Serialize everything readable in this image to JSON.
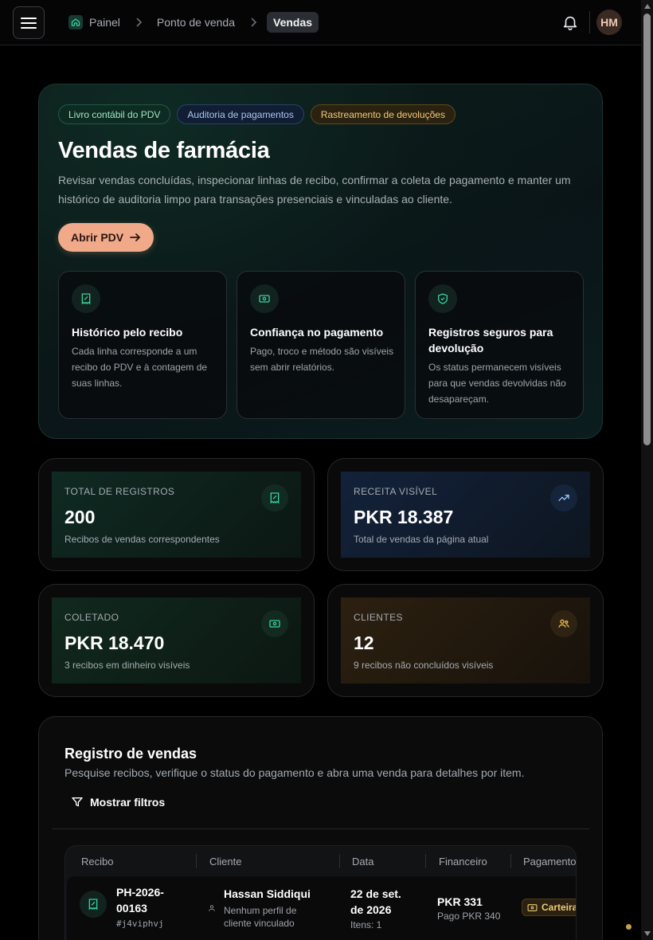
{
  "breadcrumb": {
    "home": "Painel",
    "section": "Ponto de venda",
    "current": "Vendas"
  },
  "user": {
    "initials": "HM"
  },
  "hero": {
    "chips": [
      "Livro contábil do PDV",
      "Auditoria de pagamentos",
      "Rastreamento de devoluções"
    ],
    "title": "Vendas de farmácia",
    "description": "Revisar vendas concluídas, inspecionar linhas de recibo, confirmar a coleta de pagamento e manter um histórico de auditoria limpo para transações presenciais e vinculadas ao cliente.",
    "cta_label": "Abrir PDV",
    "features": [
      {
        "title": "Histórico pelo recibo",
        "text": "Cada linha corresponde a um recibo do PDV e à contagem de suas linhas.",
        "icon": "receipt-icon"
      },
      {
        "title": "Confiança no pagamento",
        "text": "Pago, troco e método são visíveis sem abrir relatórios.",
        "icon": "banknote-icon"
      },
      {
        "title": "Registros seguros para devolução",
        "text": "Os status permanecem visíveis para que vendas devolvidas não desapareçam.",
        "icon": "shield-check-icon"
      }
    ]
  },
  "stats": [
    {
      "label": "TOTAL DE REGISTROS",
      "value": "200",
      "sub": "Recibos de vendas correspondentes",
      "icon": "receipt-icon",
      "accent": "#34d399"
    },
    {
      "label": "RECEITA VISÍVEL",
      "value": "PKR 18.387",
      "sub": "Total de vendas da página atual",
      "icon": "trending-up-icon",
      "accent": "#93c5fd"
    },
    {
      "label": "COLETADO",
      "value": "PKR 18.470",
      "sub": "3 recibos em dinheiro visíveis",
      "icon": "banknote-icon",
      "accent": "#34d399"
    },
    {
      "label": "CLIENTES",
      "value": "12",
      "sub": "9 recibos não concluídos visíveis",
      "icon": "users-icon",
      "accent": "#f0b95a"
    }
  ],
  "register": {
    "title": "Registro de vendas",
    "subtitle": "Pesquise recibos, verifique o status do pagamento e abra uma venda para detalhes por item.",
    "filters_label": "Mostrar filtros",
    "columns": [
      "Recibo",
      "Cliente",
      "Data",
      "Financeiro",
      "Pagamento"
    ],
    "rows": [
      {
        "receipt_line1": "PH-2026-",
        "receipt_line2": "00163",
        "receipt_code": "#j4viphvj",
        "customer": "Hassan Siddiqui",
        "customer_note_line1": "Nenhum perfil de",
        "customer_note_line2": "cliente vinculado",
        "date_line1": "22 de set.",
        "date_line2": "de 2026",
        "items": "Itens: 1",
        "amount": "PKR 331",
        "paid": "Pago PKR 340",
        "payment": "Carteira"
      }
    ]
  },
  "colors": {
    "accent_cta": "#f0a989",
    "brand_green": "#34d399"
  }
}
